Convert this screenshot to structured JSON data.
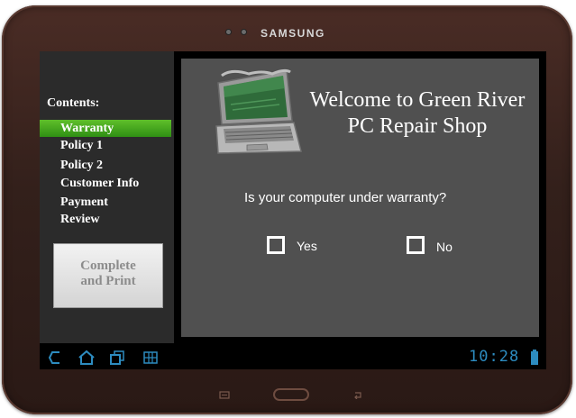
{
  "device": {
    "brand": "SAMSUNG"
  },
  "sidebar": {
    "title": "Contents:",
    "items": [
      {
        "label": "Warranty",
        "active": true
      },
      {
        "label": "Policy 1",
        "active": false
      },
      {
        "label": "Policy 2",
        "active": false
      },
      {
        "label": "Customer Info",
        "active": false
      },
      {
        "label": "Payment",
        "active": false
      },
      {
        "label": "Review",
        "active": false
      }
    ],
    "complete_button": {
      "line1": "Complete",
      "line2": "and Print"
    }
  },
  "main": {
    "welcome_line1": "Welcome to Green River",
    "welcome_line2": "PC Repair Shop",
    "question": "Is your computer under warranty?",
    "options": [
      {
        "label": "Yes",
        "checked": false
      },
      {
        "label": "No",
        "checked": false
      }
    ],
    "illustration": "laptop-icon"
  },
  "system_bar": {
    "clock": "10:28",
    "icons": [
      "back-icon",
      "home-icon",
      "recent-apps-icon",
      "screenshot-icon",
      "battery-icon"
    ]
  },
  "colors": {
    "active_nav": "#3fa01c",
    "panel": "#505050",
    "sidebar": "#2b2b2b",
    "clock": "#2d8cc0",
    "bezel": "#3a231d"
  }
}
